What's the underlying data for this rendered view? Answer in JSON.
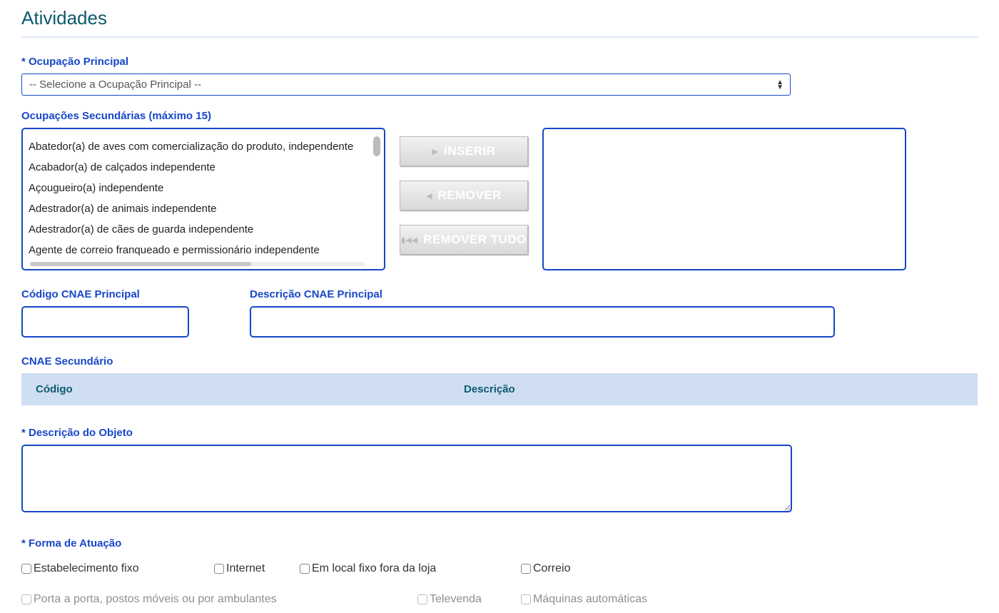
{
  "section_title": "Atividades",
  "ocupacao_principal": {
    "label": "* Ocupação Principal",
    "placeholder": "-- Selecione a Ocupação Principal --"
  },
  "ocupacoes_secundarias": {
    "label": "Ocupações Secundárias (máximo 15)",
    "source_items": [
      "Abatedor(a) de aves com comercialização do produto, independente",
      "Acabador(a) de calçados independente",
      "Açougueiro(a) independente",
      "Adestrador(a) de animais independente",
      "Adestrador(a) de cães de guarda independente",
      "Agente de correio franqueado e permissionário independente"
    ],
    "buttons": {
      "insert": "INSERIR",
      "remove": "REMOVER",
      "remove_all": "REMOVER TUDO"
    }
  },
  "cnae_principal_codigo_label": "Código CNAE Principal",
  "cnae_principal_descricao_label": "Descrição CNAE Principal",
  "cnae_secundario_label": "CNAE Secundário",
  "table_headers": {
    "codigo": "Código",
    "descricao": "Descrição"
  },
  "descricao_objeto_label": "* Descrição do Objeto",
  "forma_atuacao": {
    "label": "* Forma de Atuação",
    "row1": {
      "c1": "Estabelecimento fixo",
      "c2": "Internet",
      "c3": "Em local fixo fora da loja",
      "c4": "Correio"
    },
    "row2": {
      "c1": "Porta a porta, postos móveis ou por ambulantes",
      "c2": "Televenda",
      "c3": "Máquinas automáticas"
    }
  }
}
